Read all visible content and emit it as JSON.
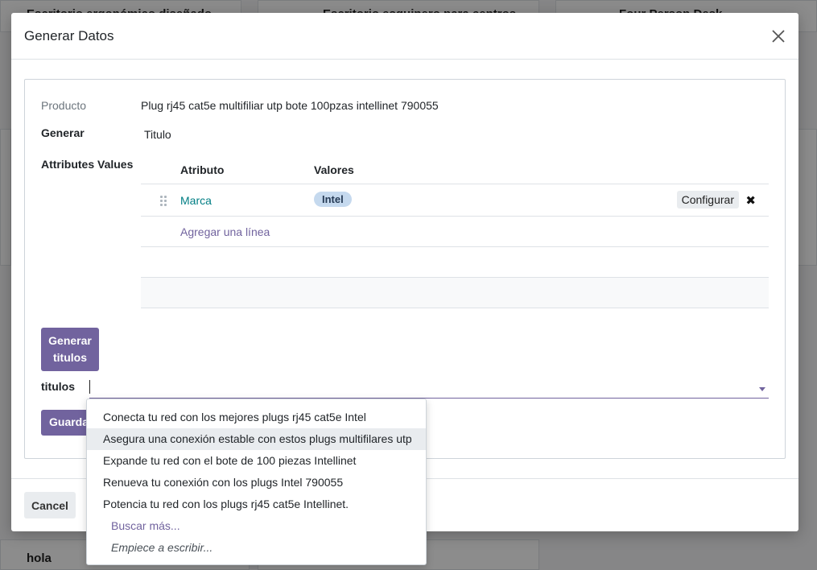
{
  "background": {
    "cards": [
      "Escritorio ergonómico diseñado",
      "Escritorio esquinero para centros",
      "Four Person Desk",
      "hola"
    ]
  },
  "modal": {
    "title": "Generar Datos",
    "close_icon": "close-icon"
  },
  "form": {
    "producto_label": "Producto",
    "producto_value": "Plug rj45 cat5e multifiliar utp bote 100pzas intellinet 790055",
    "generar_label": "Generar",
    "generar_value": "Titulo",
    "attributes_label": "Attributes Values",
    "table": {
      "headers": [
        "Atributo",
        "Valores"
      ],
      "rows": [
        {
          "atributo": "Marca",
          "valores": [
            "Intel"
          ],
          "action": "Configurar"
        }
      ],
      "add_line": "Agregar una línea"
    },
    "generate_button": [
      "Generar",
      "titulos"
    ],
    "titulos_label": "titulos",
    "titulos_value": "",
    "save_button": "Guardar"
  },
  "dropdown": {
    "items": [
      "Conecta tu red con los mejores plugs rj45 cat5e Intel",
      "Asegura una conexión estable con estos plugs multifilares utp",
      "Expande tu red con el bote de 100 piezas Intellinet",
      "Renueva tu conexión con los plugs Intel 790055",
      "Potencia tu red con los plugs rj45 cat5e Intellinet."
    ],
    "active_index": 1,
    "more": "Buscar más...",
    "hint": "Empiece a escribir..."
  },
  "footer": {
    "cancel": "Cancel"
  }
}
